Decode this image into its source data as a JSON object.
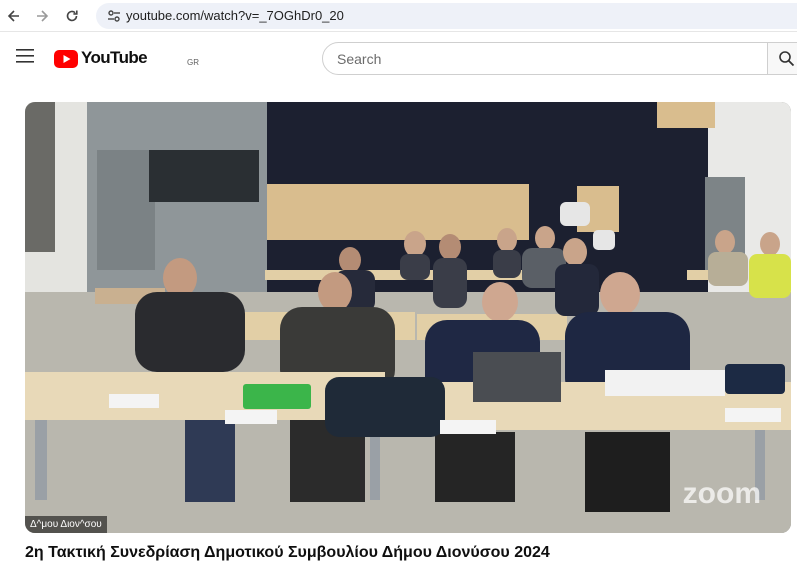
{
  "browser": {
    "url": "youtube.com/watch?v=_7OGhDr0_20"
  },
  "header": {
    "logo_text": "YouTube",
    "country_code": "GR",
    "search_placeholder": "Search"
  },
  "video": {
    "channel_overlay": "Δ^μου Διον^σου",
    "watermark": "zoom",
    "title": "2η Τακτική Συνεδρίαση Δημοτικού Συμβουλίου Δήμου Διονύσου 2024"
  },
  "colors": {
    "brand_red": "#ff0000",
    "table": "#e8d9b8",
    "floor": "#b9b7ae",
    "back_wall": "#1c2030",
    "paneling": "#d9bd8e"
  }
}
